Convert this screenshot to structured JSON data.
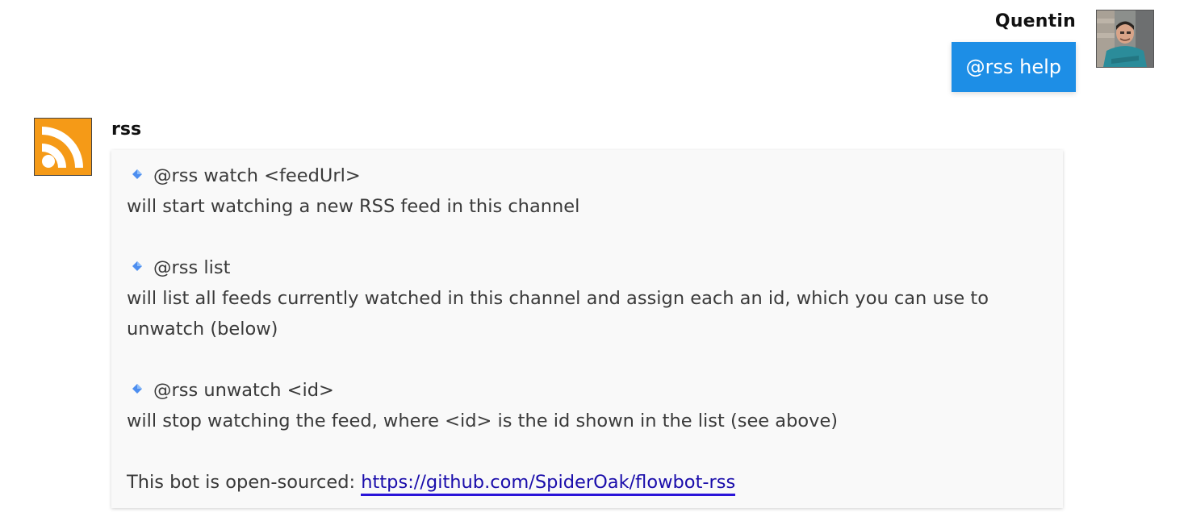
{
  "outgoing": {
    "sender": "Quentin",
    "text": "@rss help"
  },
  "incoming": {
    "sender": "rss",
    "commands": [
      {
        "command": "@rss watch <feedUrl>",
        "description": "will start watching a new RSS feed in this channel"
      },
      {
        "command": "@rss list",
        "description": "will list all feeds currently watched in this channel and assign each an id, which you can use to unwatch (below)"
      },
      {
        "command": "@rss unwatch <id>",
        "description": "will stop watching the feed, where <id> is the id shown in the list (see above)"
      }
    ],
    "footer_text": "This bot is open-sourced: ",
    "footer_link": "https://github.com/SpiderOak/flowbot-rss"
  },
  "icons": {
    "bullet": "small-blue-diamond-icon",
    "bot_avatar": "rss-feed-icon",
    "user_avatar": "user-photo"
  },
  "colors": {
    "bubble": "#1d8ee6",
    "rss_orange": "#f59a17",
    "link": "#1a0dab"
  }
}
